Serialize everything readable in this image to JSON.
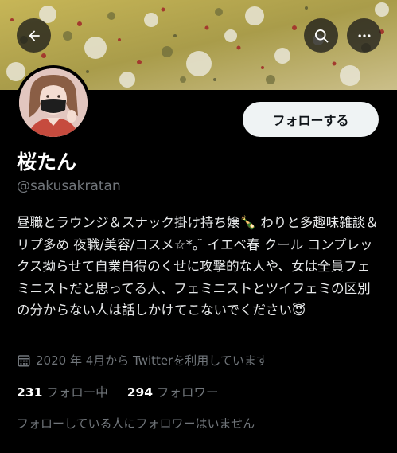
{
  "header": {
    "back_icon": "arrow-left-icon",
    "search_icon": "search-icon",
    "more_icon": "more-horizontal-icon"
  },
  "profile": {
    "display_name": "桜たん",
    "handle": "@sakusakratan",
    "follow_button_label": "フォローする",
    "bio": "昼職とラウンジ＆スナック掛け持ち嬢🍾 わりと多趣味雑談＆リプ多め 夜職/美容/コスメ☆*｡ ̈ イエベ春 クール コンプレックス拗らせて自業自得のくせに攻撃的な人や、女は全員フェミニストだと思ってる人、フェミニストとツイフェミの区別の分からない人は話しかけてこないでください😇",
    "joined": "2020 年 4月から Twitterを利用しています",
    "following_count": "231",
    "following_label": "フォロー中",
    "followers_count": "294",
    "followers_label": "フォロワー",
    "mutual_note": "フォローしている人にフォロワーはいません"
  },
  "colors": {
    "background": "#000000",
    "text_primary": "#e7e9ea",
    "text_secondary": "#71767b",
    "follow_button_bg": "#eff3f4",
    "banner_base": "#b9a648"
  }
}
